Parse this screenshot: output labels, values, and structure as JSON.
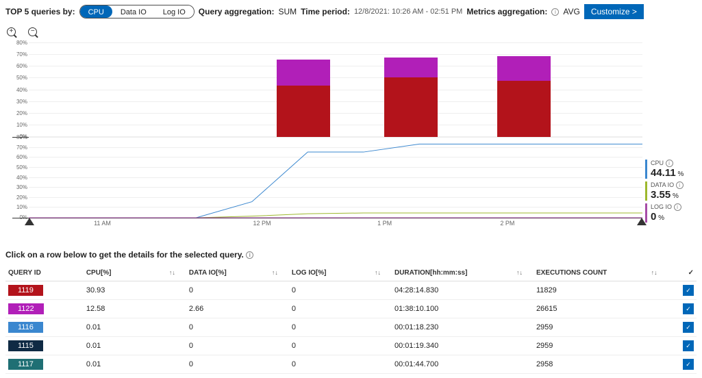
{
  "topbar": {
    "top5_label": "TOP 5 queries by:",
    "pill_cpu": "CPU",
    "pill_dataio": "Data IO",
    "pill_logio": "Log IO",
    "qagg_label": "Query aggregation:",
    "qagg_value": "SUM",
    "tperiod_label": "Time period:",
    "tperiod_value": "12/8/2021: 10:26 AM - 02:51 PM",
    "magg_label": "Metrics aggregation:",
    "magg_value": "AVG",
    "customize": "Customize >"
  },
  "chart_data": [
    {
      "type": "bar",
      "stacked": true,
      "ylim": [
        0,
        80
      ],
      "yticks": [
        "0%",
        "10%",
        "20%",
        "30%",
        "40%",
        "50%",
        "60%",
        "70%",
        "80%"
      ],
      "categories": [
        "12 PM",
        "1 PM",
        "2 PM"
      ],
      "series": [
        {
          "name": "1119",
          "color": "#b3131b",
          "values": [
            44,
            51,
            48
          ]
        },
        {
          "name": "1122",
          "color": "#b11fb8",
          "values": [
            22,
            17,
            21
          ]
        }
      ]
    },
    {
      "type": "line",
      "ylim": [
        0,
        80
      ],
      "yticks": [
        "0%",
        "10%",
        "20%",
        "30%",
        "40%",
        "50%",
        "60%",
        "70%",
        "80%"
      ],
      "xticks": [
        "11 AM",
        "12 PM",
        "1 PM",
        "2 PM"
      ],
      "range_markers": [
        0,
        100
      ],
      "series": [
        {
          "name": "CPU",
          "color": "#3a87cf",
          "values_pct_of_ylim": [
            0,
            0,
            0,
            0,
            20,
            82,
            82,
            92,
            92,
            92,
            92,
            92
          ]
        },
        {
          "name": "DATA IO",
          "color": "#9db82d",
          "values_pct_of_ylim": [
            0,
            0,
            0,
            0,
            2,
            5,
            6,
            6,
            6,
            6,
            6,
            6
          ]
        },
        {
          "name": "LOG IO",
          "color": "#a64ca6",
          "values_pct_of_ylim": [
            0,
            0,
            0,
            0,
            0,
            0,
            0,
            0,
            0,
            0,
            0,
            0
          ]
        }
      ]
    }
  ],
  "legend": {
    "rows": [
      {
        "name": "CPU",
        "value": "44.11",
        "unit": "%",
        "color": "#3a87cf"
      },
      {
        "name": "DATA IO",
        "value": "3.55",
        "unit": "%",
        "color": "#9db82d"
      },
      {
        "name": "LOG IO",
        "value": "0",
        "unit": "%",
        "color": "#a64ca6"
      }
    ]
  },
  "table_hint": "Click on a row below to get the details for the selected query.",
  "table": {
    "columns": [
      "QUERY ID",
      "CPU[%]",
      "DATA IO[%]",
      "LOG IO[%]",
      "DURATION[hh:mm:ss]",
      "EXECUTIONS COUNT",
      "✓"
    ],
    "sort_glyph": "↑↓",
    "rows": [
      {
        "id": "1119",
        "color": "#b3131b",
        "cpu": "30.93",
        "dio": "0",
        "lio": "0",
        "dur": "04:28:14.830",
        "exc": "11829",
        "chk": true
      },
      {
        "id": "1122",
        "color": "#b11fb8",
        "cpu": "12.58",
        "dio": "2.66",
        "lio": "0",
        "dur": "01:38:10.100",
        "exc": "26615",
        "chk": true
      },
      {
        "id": "1116",
        "color": "#3a87cf",
        "cpu": "0.01",
        "dio": "0",
        "lio": "0",
        "dur": "00:01:18.230",
        "exc": "2959",
        "chk": true
      },
      {
        "id": "1115",
        "color": "#0f2a44",
        "cpu": "0.01",
        "dio": "0",
        "lio": "0",
        "dur": "00:01:19.340",
        "exc": "2959",
        "chk": true
      },
      {
        "id": "1117",
        "color": "#1f6f74",
        "cpu": "0.01",
        "dio": "0",
        "lio": "0",
        "dur": "00:01:44.700",
        "exc": "2958",
        "chk": true
      }
    ]
  }
}
